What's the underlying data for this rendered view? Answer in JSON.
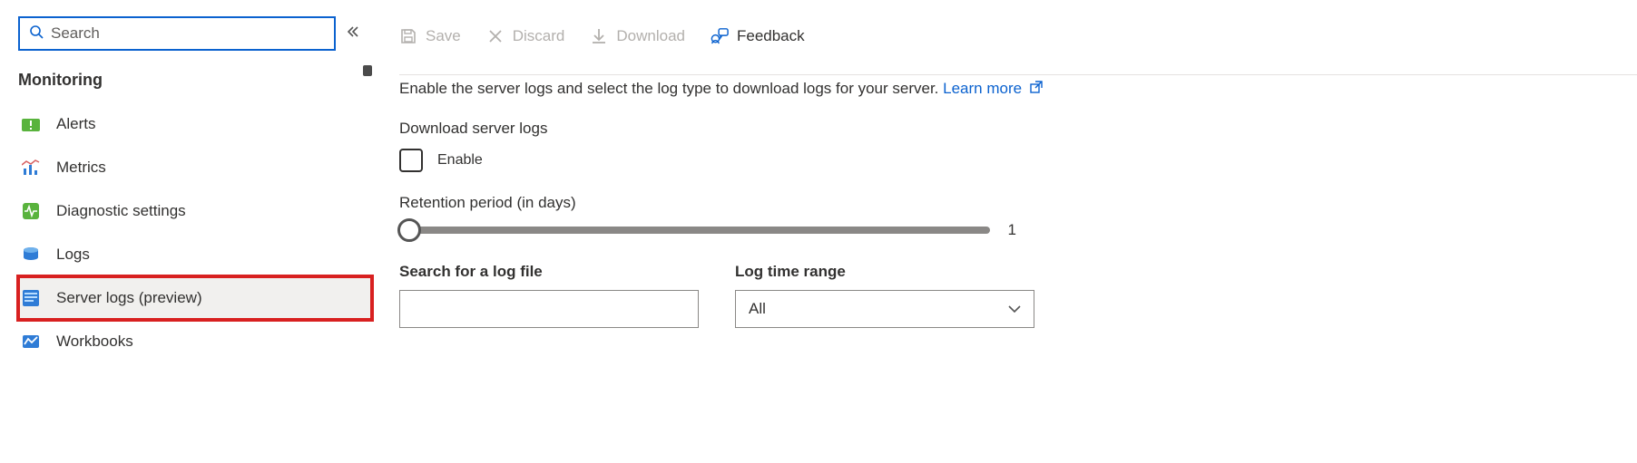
{
  "sidebar": {
    "search_placeholder": "Search",
    "section": "Monitoring",
    "items": [
      {
        "label": "Alerts",
        "icon": "alerts",
        "selected": false
      },
      {
        "label": "Metrics",
        "icon": "metrics",
        "selected": false
      },
      {
        "label": "Diagnostic settings",
        "icon": "diagnostic",
        "selected": false
      },
      {
        "label": "Logs",
        "icon": "logs",
        "selected": false
      },
      {
        "label": "Server logs (preview)",
        "icon": "serverlogs",
        "selected": true
      },
      {
        "label": "Workbooks",
        "icon": "workbooks",
        "selected": false
      }
    ]
  },
  "toolbar": {
    "save": "Save",
    "discard": "Discard",
    "download": "Download",
    "feedback": "Feedback"
  },
  "main": {
    "description": "Enable the server logs and select the log type to download logs for your server.",
    "learn_more": "Learn more",
    "download_section": "Download server logs",
    "enable_label": "Enable",
    "retention_label": "Retention period (in days)",
    "retention_value": "1",
    "search_label": "Search for a log file",
    "timerange_label": "Log time range",
    "timerange_value": "All"
  }
}
